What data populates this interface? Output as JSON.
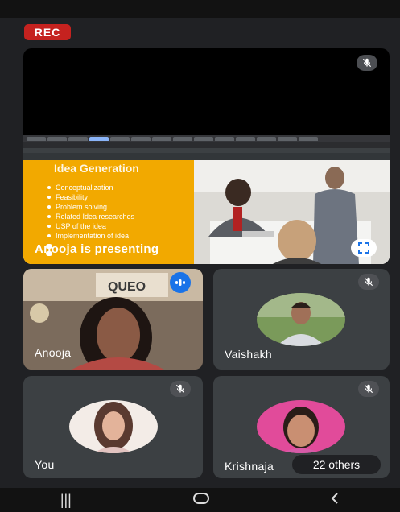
{
  "recording": {
    "label": "REC"
  },
  "presentation": {
    "status_text": "Anooja is presenting",
    "slide_title": "Idea Generation",
    "slide_points": [
      "Conceptualization",
      "Feasibility",
      "Problem solving",
      "Related Idea researches",
      "USP of the idea",
      "Implementation of idea"
    ]
  },
  "participants": [
    {
      "name": "Anooja"
    },
    {
      "name": "Vaishakh"
    },
    {
      "name": "You"
    },
    {
      "name": "Krishnaja"
    }
  ],
  "others": {
    "label": "22 others"
  },
  "colors": {
    "rec": "#c5221f",
    "tile": "#3c4043",
    "background": "#202124",
    "slide_accent": "#f2a900"
  }
}
